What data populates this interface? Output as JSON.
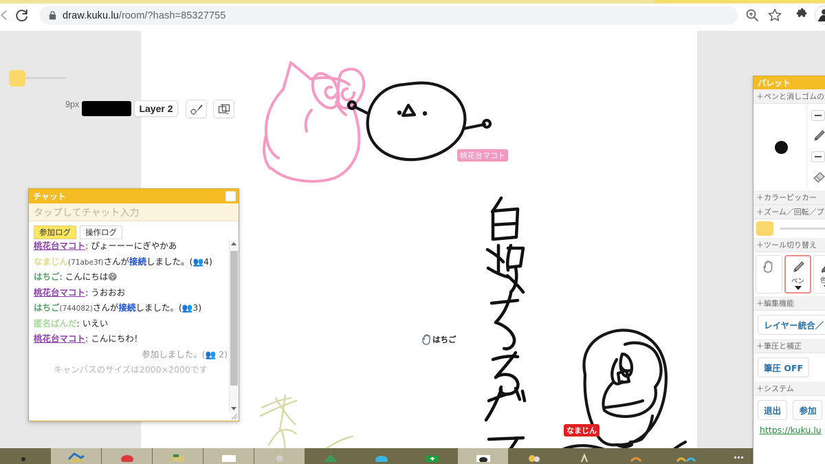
{
  "browser": {
    "url_main": "draw.kuku.lu",
    "url_path": "/room/?hash=85327755",
    "lock_icon": "lock-icon",
    "reload_icon": "reload-icon",
    "zoom_icon": "zoom-icon",
    "star_icon": "star-icon",
    "extensions_icon": "puzzle-extensions-icon",
    "avatar_icon": "profile-avatar-icon"
  },
  "toolbar": {
    "pen_size": "9px",
    "current_color": "#000000",
    "swatch_color": "#fcd769",
    "layer_label": "Layer 2",
    "brush_settings_icon": "brush-settings-icon",
    "layer_tool_icon": "layer-duplicate-icon"
  },
  "chat": {
    "title": "チャット",
    "input_placeholder": "タップしてチャット入力",
    "close_label": "",
    "tabs": [
      {
        "label": "参加ログ",
        "active": true
      },
      {
        "label": "操作ログ",
        "active": false
      }
    ],
    "messages": [
      {
        "type": "chat",
        "user": "桃花台マコト",
        "user_class": "u-momo",
        "text": "ぴょーーーにぎやかあ"
      },
      {
        "type": "join",
        "user": "なまじん",
        "user_class": "u-nama",
        "id": "(71abe3f)",
        "mid": "さんが",
        "verb": "接続",
        "tail": "しました。(",
        "count": "4",
        "close": ")"
      },
      {
        "type": "chat",
        "user": "はちご",
        "user_class": "u-hachi",
        "text": "こんにちは😄"
      },
      {
        "type": "chat",
        "user": "桃花台マコト",
        "user_class": "u-momo",
        "text": "うおおお"
      },
      {
        "type": "join",
        "user": "はちご",
        "user_class": "u-hachi",
        "id": "(744082)",
        "mid": "さんが",
        "verb": "接続",
        "tail": "しました。(",
        "count": "3",
        "close": ")"
      },
      {
        "type": "chat",
        "user": "匿名ぱんだ",
        "user_class": "u-panda",
        "text": "いえい"
      },
      {
        "type": "chat",
        "user": "桃花台マコト",
        "user_class": "u-momo",
        "text": "こんにちわ！"
      },
      {
        "type": "system",
        "text": "参加しました。(👥 2)"
      },
      {
        "type": "cut",
        "text": "キャンバスのサイズは2000×2000です"
      }
    ]
  },
  "palette": {
    "title": "パレット",
    "sections": {
      "pen_eraser_size": "＋ペンと消しゴムの大きさ",
      "color_picker": "＋カラーピッカー",
      "zoom_rotate": "＋ズーム／回転／プレビュー",
      "tool_switch": "＋ツール切り替え",
      "edit_functions": "＋編集機能",
      "pressure_correction": "＋筆圧と補正",
      "system": "＋システム"
    },
    "pen_icon": "pen-icon",
    "eraser_icon": "eraser-icon",
    "minus_icon": "minus-icon",
    "swatch_color": "#fcd769",
    "tools": [
      {
        "name": "hand-tool",
        "icon": "hand-icon",
        "label": "",
        "selected": false
      },
      {
        "name": "pen-tool",
        "icon": "pen-icon",
        "label": "ペン",
        "selected": true
      },
      {
        "name": "color-tool",
        "icon": "eyedropper-icon",
        "label": "色の",
        "selected": false
      }
    ],
    "edit_button": "レイヤー統合／",
    "pressure_button": "筆圧 OFF",
    "system_buttons": [
      "退出",
      "参加"
    ],
    "system_link": "https://kuku.lu"
  },
  "canvas": {
    "nametags": [
      {
        "name": "momohanadai-makoto-tag",
        "text": "桃花台マコト",
        "color": "#f49ac1"
      },
      {
        "name": "namajin-tag",
        "text": "なまじん",
        "color": "#e02020"
      }
    ],
    "cursors": [
      {
        "name": "hachigo-cursor",
        "label": "はちご",
        "icon": "hand-cursor-icon"
      }
    ],
    "handwritten_text": "白殺するゲマ",
    "drawings": [
      {
        "name": "pink-cat-drawing",
        "color": "#f49ac1"
      },
      {
        "name": "blob-face-drawing",
        "color": "#111111"
      },
      {
        "name": "person-face-drawing",
        "color": "#111111"
      },
      {
        "name": "yellow-scribble",
        "color": "#d8d8a0"
      }
    ]
  },
  "taskbar": {
    "items": [
      {
        "name": "taskbar-item-1",
        "style": "dark"
      },
      {
        "name": "taskbar-item-2",
        "style": "lite"
      },
      {
        "name": "taskbar-item-3",
        "style": "lite"
      },
      {
        "name": "taskbar-item-4",
        "style": "lite"
      },
      {
        "name": "taskbar-item-5",
        "style": "lite"
      },
      {
        "name": "taskbar-item-6",
        "style": "lite"
      },
      {
        "name": "taskbar-item-7",
        "style": "dark"
      },
      {
        "name": "taskbar-item-8",
        "style": "dark"
      },
      {
        "name": "taskbar-item-9",
        "style": "dark"
      },
      {
        "name": "taskbar-item-10",
        "style": "dark"
      },
      {
        "name": "taskbar-item-11",
        "style": "lite"
      },
      {
        "name": "taskbar-item-12",
        "style": "dark"
      },
      {
        "name": "taskbar-item-13",
        "style": "dark"
      },
      {
        "name": "taskbar-item-14",
        "style": "dark"
      },
      {
        "name": "taskbar-item-15",
        "style": "dark"
      },
      {
        "name": "taskbar-item-16",
        "style": "dark"
      }
    ]
  }
}
